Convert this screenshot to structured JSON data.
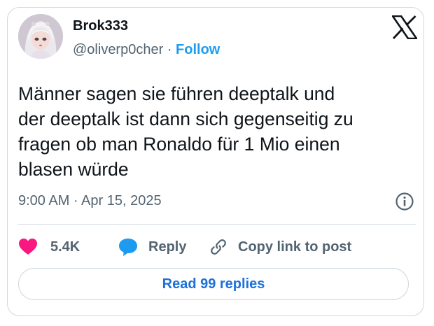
{
  "author": {
    "display_name": "Brok333",
    "handle": "@oliverp0cher",
    "separator": "·",
    "follow_label": "Follow"
  },
  "tweet": {
    "text_lines": [
      "Männer sagen sie führen deeptalk und",
      "der deeptalk ist dann sich gegenseitig zu",
      "fragen ob man Ronaldo für 1 Mio einen",
      "blasen würde"
    ],
    "timestamp": "9:00 AM · Apr 15, 2025"
  },
  "actions": {
    "like_count": "5.4K",
    "reply_label": "Reply",
    "copy_link_label": "Copy link to post"
  },
  "read_replies_label": "Read 99 replies",
  "colors": {
    "accent_blue": "#1d9bf0",
    "like_pink": "#f91880",
    "text_secondary": "#536471",
    "border": "#cfd9de"
  },
  "icons": [
    "x-logo-icon",
    "info-icon",
    "heart-icon",
    "reply-bubble-icon",
    "link-icon"
  ]
}
